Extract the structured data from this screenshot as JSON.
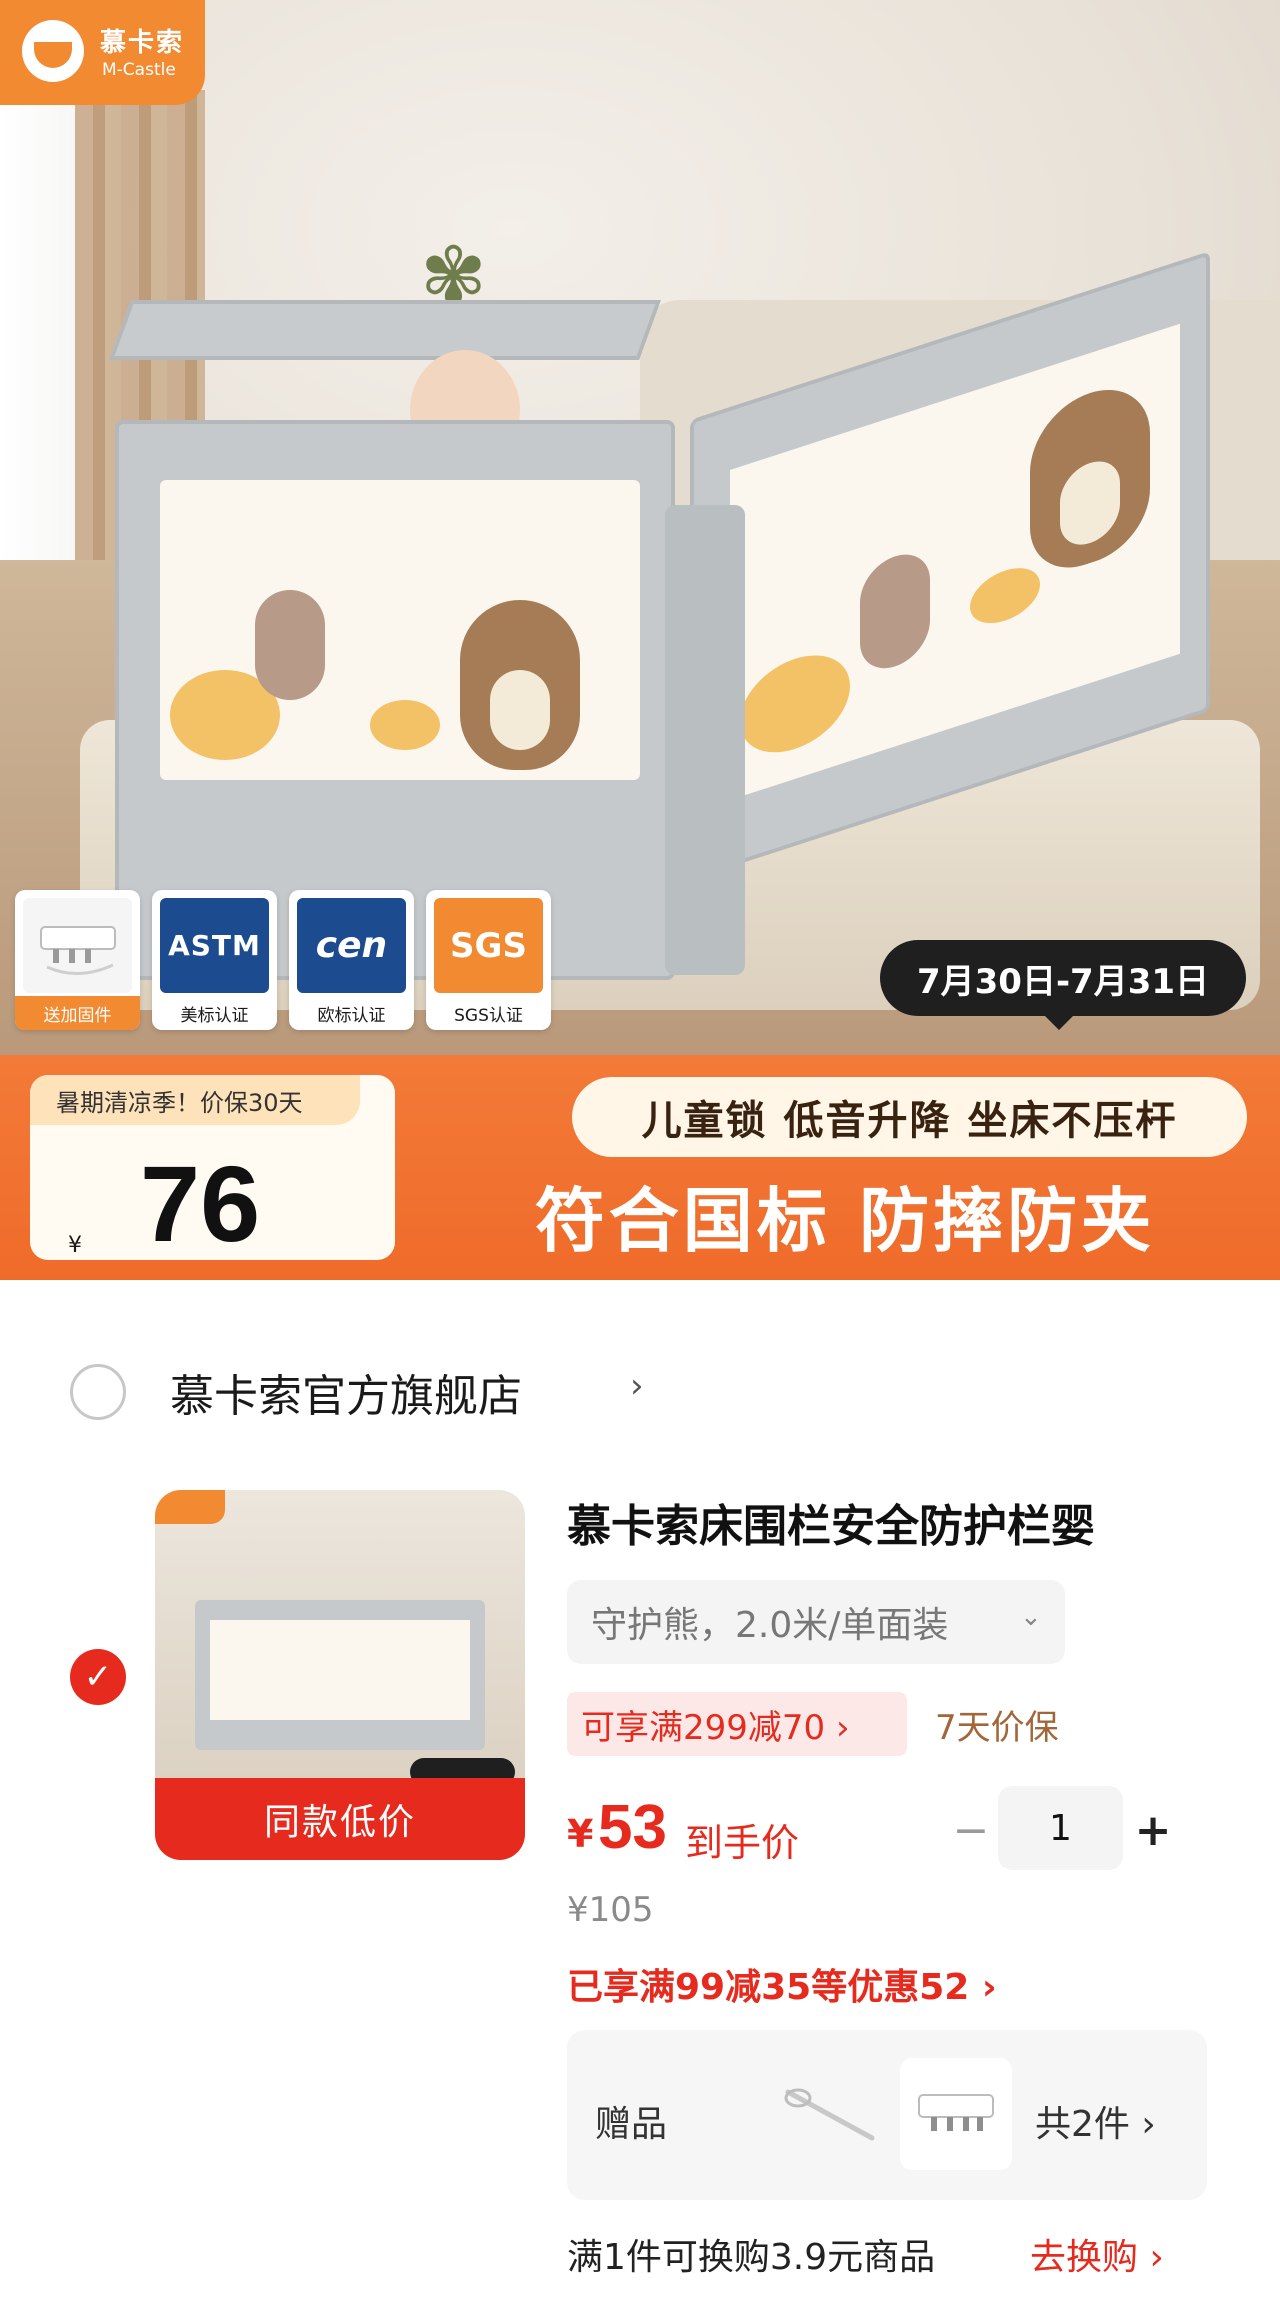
{
  "hero": {
    "brand": {
      "name_cn": "慕卡索",
      "name_en": "M-Castle"
    },
    "certs": [
      {
        "badge": "",
        "caption": "送加固件"
      },
      {
        "badge": "ASTM",
        "caption": "美标认证"
      },
      {
        "badge": "cen",
        "caption": "欧标认证"
      },
      {
        "badge": "SGS",
        "caption": "SGS认证"
      }
    ],
    "date_range": "7月30日-7月31日"
  },
  "promo": {
    "tag": "暑期清凉季！价保30天",
    "currency": "¥",
    "price": "76",
    "features": "儿童锁 低音升降 坐床不压杆",
    "headline": "符合国标 防摔防夹"
  },
  "shop": {
    "name": "慕卡索官方旗舰店",
    "chevron": "›"
  },
  "item": {
    "thumbnail_label": "同款低价",
    "title": "慕卡索床围栏安全防护栏婴",
    "variant": "守护熊，2.0米/单面装",
    "coupon": "可享满299减70 ›",
    "guarantee": "7天价保",
    "price_symbol": "¥",
    "price": "53",
    "price_suffix": "到手价",
    "original_price": "¥105",
    "discount": "已享满99减35等优惠52 ›",
    "quantity": "1",
    "qty_minus": "−",
    "qty_plus": "+",
    "selected": true
  },
  "gift": {
    "label": "赠品",
    "count": "共2件 ›"
  },
  "swap": {
    "text": "满1件可换购3.9元商品",
    "link": "去换购 ›"
  },
  "colors": {
    "accent": "#e62b1e",
    "brand_orange": "#f28a31",
    "guarantee": "#a3663a"
  }
}
